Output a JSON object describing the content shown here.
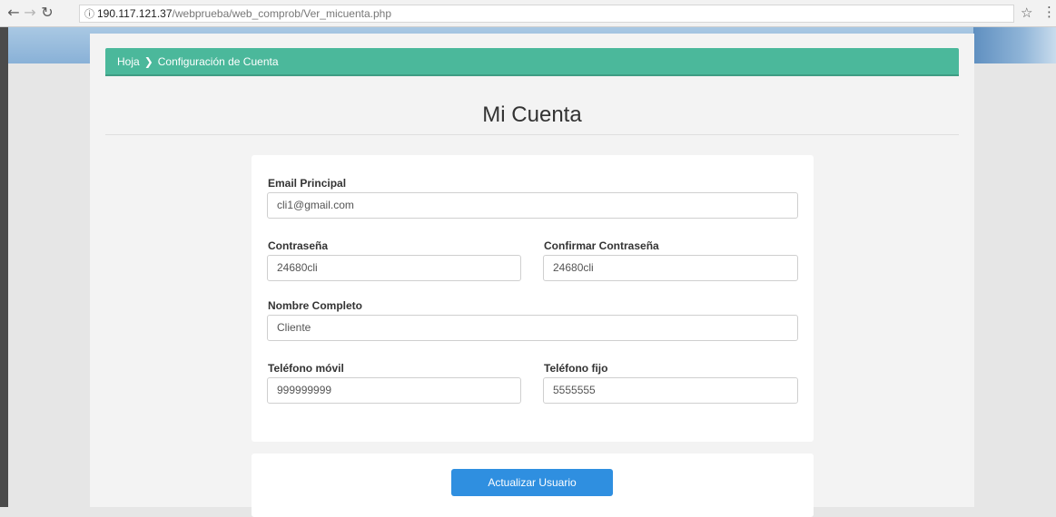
{
  "browser": {
    "back_icon": "arrow-left-icon",
    "forward_icon": "arrow-right-icon",
    "reload_icon": "reload-icon",
    "info_icon": "info-icon",
    "url_host": "190.117.121.37",
    "url_path": "/webprueba/web_comprob/Ver_micuenta.php",
    "bookmark_icon": "star-icon",
    "menu_icon": "vertical-dots-icon"
  },
  "breadcrumb": {
    "home": "Hoja",
    "separator": "❯",
    "current": "Configuración de Cuenta"
  },
  "page": {
    "title": "Mi Cuenta"
  },
  "form": {
    "email": {
      "label": "Email Principal",
      "value": "cli1@gmail.com"
    },
    "password": {
      "label": "Contraseña",
      "value": "24680cli"
    },
    "confirm_password": {
      "label": "Confirmar Contraseña",
      "value": "24680cli"
    },
    "full_name": {
      "label": "Nombre Completo",
      "value": "Cliente"
    },
    "mobile": {
      "label": "Teléfono móvil",
      "value": "999999999"
    },
    "landline": {
      "label": "Teléfono fijo",
      "value": "5555555"
    }
  },
  "actions": {
    "update_label": "Actualizar Usuario"
  },
  "colors": {
    "breadcrumb_bg": "#4bb89b",
    "button_bg": "#2f8fe0",
    "content_bg": "#f3f3f3"
  }
}
